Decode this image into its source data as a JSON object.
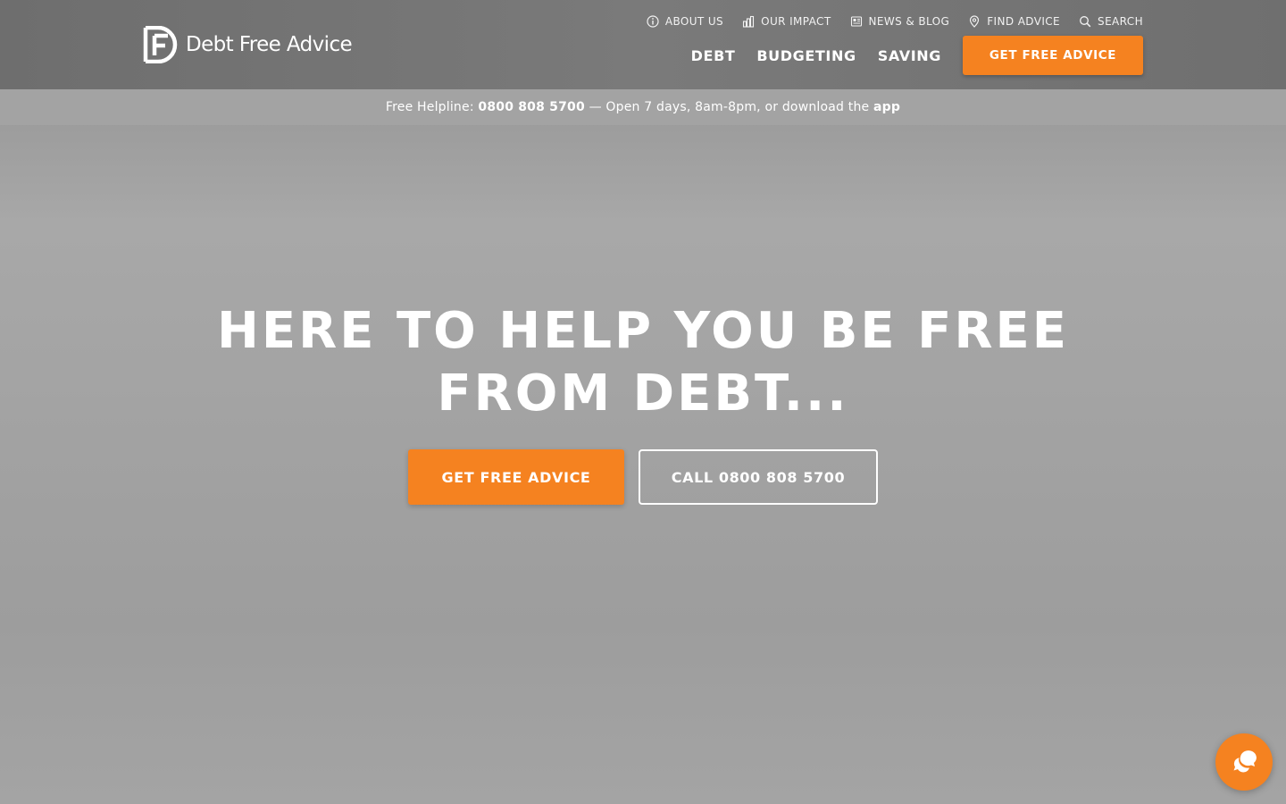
{
  "brand": {
    "name": "Debt Free Advice",
    "accent_color": "#f58220"
  },
  "utility_nav": [
    {
      "label": "ABOUT US",
      "icon": "info-icon"
    },
    {
      "label": "OUR IMPACT",
      "icon": "bar-chart-icon"
    },
    {
      "label": "NEWS & BLOG",
      "icon": "newspaper-icon"
    },
    {
      "label": "FIND ADVICE",
      "icon": "map-pin-icon"
    },
    {
      "label": "SEARCH",
      "icon": "search-icon"
    }
  ],
  "main_nav": {
    "items": [
      "DEBT",
      "BUDGETING",
      "SAVING"
    ],
    "cta_label": "GET FREE ADVICE"
  },
  "helpline": {
    "prefix": "Free Helpline:",
    "number": "0800 808 5700",
    "suffix": "— Open 7 days, 8am-8pm, or download the",
    "app_link": "app"
  },
  "hero": {
    "title": "HERE TO HELP YOU BE FREE FROM DEBT...",
    "primary_button": "GET FREE ADVICE",
    "secondary_button": "CALL 0800 808 5700"
  },
  "chat": {
    "icon": "chat-icon"
  }
}
